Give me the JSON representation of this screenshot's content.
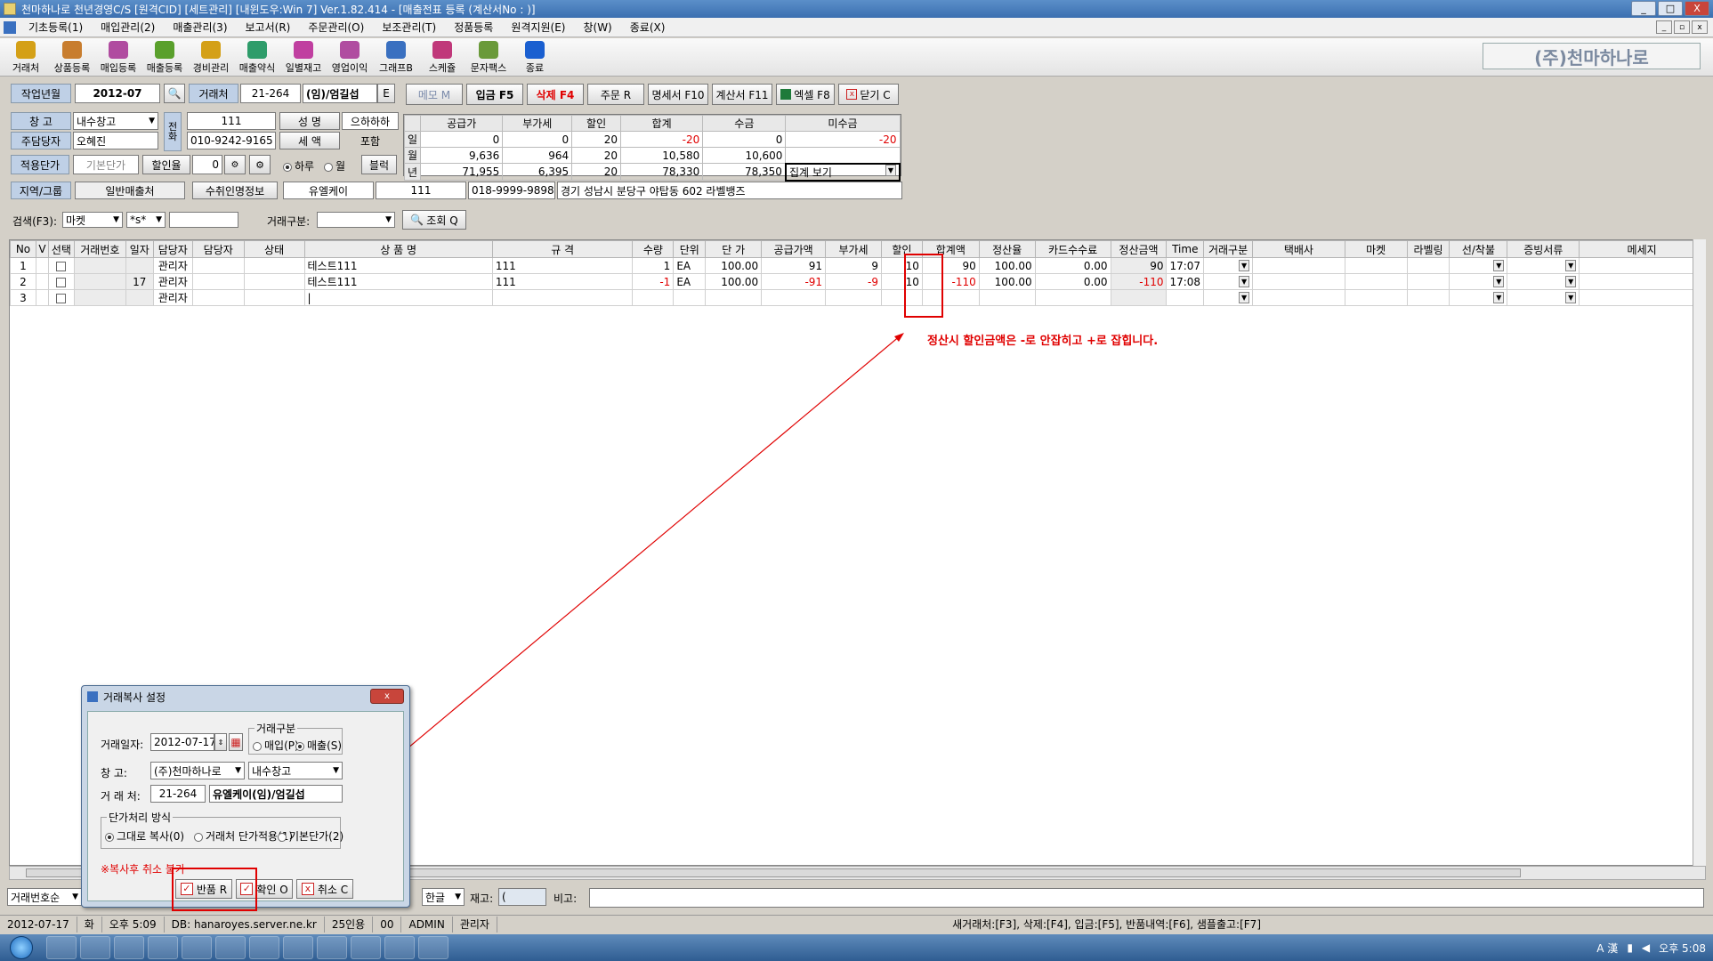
{
  "window": {
    "title": "천마하나로 천년경영C/S [원격CID] [세트관리] [내윈도우:Win 7] Ver.1.82.414 - [매출전표 등록 (계산서No : )]",
    "min": "_",
    "max": "□",
    "close": "X"
  },
  "menu": [
    "기초등록(1)",
    "매입관리(2)",
    "매출관리(3)",
    "보고서(R)",
    "주문관리(O)",
    "보조관리(T)",
    "정품등록",
    "원격지원(E)",
    "창(W)",
    "종료(X)"
  ],
  "toolbar": [
    {
      "label": "거래처",
      "icon": "handshake-icon",
      "color": "#d4a017"
    },
    {
      "label": "상품등록",
      "icon": "box-icon",
      "color": "#c87d2e"
    },
    {
      "label": "매입등록",
      "icon": "purchase-icon",
      "color": "#b04ca0"
    },
    {
      "label": "매출등록",
      "icon": "sales-icon",
      "color": "#5aa02c"
    },
    {
      "label": "경비관리",
      "icon": "coins-icon",
      "color": "#d4a017"
    },
    {
      "label": "매출약식",
      "icon": "pen-icon",
      "color": "#2e9c6a"
    },
    {
      "label": "일별재고",
      "icon": "stock-icon",
      "color": "#c03fa0"
    },
    {
      "label": "영업이익",
      "icon": "profit-icon",
      "color": "#b04ca0"
    },
    {
      "label": "그래프B",
      "icon": "graph-icon",
      "color": "#3a70c0"
    },
    {
      "label": "스케쥴",
      "icon": "schedule-icon",
      "color": "#c0387a"
    },
    {
      "label": "문자팩스",
      "icon": "phone-icon",
      "color": "#6a9a3a"
    },
    {
      "label": "종료",
      "icon": "exit-icon",
      "color": "#1a5fd0"
    }
  ],
  "brand": "(주)천마하나로",
  "header": {
    "workmonth_label": "작업년월",
    "workmonth": "2012-07",
    "client_label": "거래처",
    "client_code": "21-264",
    "client_name": "(임)/엄길섭",
    "e_btn": "E",
    "memo_btn": "메모 M",
    "deposit_btn": "입금 F5",
    "delete_btn": "삭제 F4",
    "order_btn": "주문 R",
    "statement_btn": "명세서 F10",
    "invoice_btn": "계산서 F11",
    "excel_btn": "엑셀 F8",
    "close_btn": "닫기 C"
  },
  "form": {
    "warehouse_label": "창   고",
    "warehouse": "내수창고",
    "manager_label": "주담당자",
    "manager": "오혜진",
    "price_label": "적용단가",
    "price": "기본단가",
    "discount_label": "할인율",
    "discount": "0",
    "phone_label": "전화",
    "code": "111",
    "name_label": "성 명",
    "tax_label": "세 액",
    "tax_val": "포함",
    "phone": "010-9242-9165",
    "name_right": "으하하하",
    "period_daily": "하루",
    "period_monthly": "월",
    "block_btn": "블럭"
  },
  "summary": {
    "headers": [
      "",
      "공급가",
      "부가세",
      "할인",
      "합계",
      "수금",
      "미수금"
    ],
    "rows": [
      {
        "label": "일",
        "values": [
          "0",
          "0",
          "20",
          "-20",
          "0",
          "-20"
        ]
      },
      {
        "label": "월",
        "values": [
          "9,636",
          "964",
          "20",
          "10,580",
          "10,600",
          ""
        ]
      },
      {
        "label": "년",
        "values": [
          "71,955",
          "6,395",
          "20",
          "78,330",
          "78,350",
          "집계 보기"
        ]
      }
    ]
  },
  "region": {
    "label": "지역/그룹",
    "group": "일반매출처",
    "recipient_label": "수취인명정보",
    "company": "유엘케이",
    "code": "111",
    "phone": "018-9999-9898",
    "address": "경기 성남시 분당구 야탑동 602 라벨뱅즈"
  },
  "search": {
    "label": "검색(F3):",
    "type": "마켓",
    "op": "*s*",
    "value": "",
    "trade_label": "거래구분:",
    "trade": "",
    "query_btn": "조회 Q"
  },
  "grid": {
    "headers": [
      "No",
      "V",
      "선택",
      "거래번호",
      "일자",
      "담당자",
      "담당자",
      "상태",
      "상 품 명",
      "규 격",
      "수량",
      "단위",
      "단 가",
      "공급가액",
      "부가세",
      "할인",
      "합계액",
      "정산율",
      "카드수수료",
      "정산금액",
      "Time",
      "거래구분",
      "택배사",
      "마켓",
      "라벨링",
      "선/착불",
      "증빙서류",
      "메세지"
    ],
    "rows": [
      {
        "no": "1",
        "date": "",
        "mgr": "관리자",
        "product": "테스트111",
        "spec": "111",
        "qty": "1",
        "unit": "EA",
        "price": "100.00",
        "supply": "91",
        "vat": "9",
        "disc": "10",
        "total": "90",
        "rate": "100.00",
        "card": "0.00",
        "settle": "90",
        "time": "17:07"
      },
      {
        "no": "2",
        "date": "17",
        "mgr": "관리자",
        "product": "테스트111",
        "spec": "111",
        "qty": "-1",
        "unit": "EA",
        "price": "100.00",
        "supply": "-91",
        "vat": "-9",
        "disc": "10",
        "total": "-110",
        "rate": "100.00",
        "card": "0.00",
        "settle": "-110",
        "time": "17:08"
      },
      {
        "no": "3",
        "date": "",
        "mgr": "관리자",
        "product": "|",
        "spec": "",
        "qty": "",
        "unit": "",
        "price": "",
        "supply": "",
        "vat": "",
        "disc": "",
        "total": "",
        "rate": "",
        "card": "",
        "settle": "",
        "time": ""
      }
    ]
  },
  "annotation": "정산시 할인금액은 -로 안잡히고 +로 잡힙니다.",
  "bottom": {
    "sort": "거래번호순",
    "lang": "한글",
    "stock_label": "재고:",
    "stock": "(",
    "memo_label": "비고:"
  },
  "status": [
    "2012-07-17",
    "화",
    "오후 5:09",
    "DB: hanaroyes.server.ne.kr",
    "25인용",
    "00",
    "ADMIN",
    "관리자"
  ],
  "status_right": "새거래처:[F3], 삭제:[F4], 입금:[F5], 반품내역:[F6], 샘플출고:[F7]",
  "tray": {
    "lang": "A 漢",
    "time": "오후 5:08"
  },
  "dialog": {
    "title": "거래복사 설정",
    "date_label": "거래일자:",
    "date": "2012-07-17",
    "trade_group": "거래구분",
    "buy": "매입(P)",
    "sell": "매출(S)",
    "wh_label": "창     고:",
    "wh_company": "(주)천마하나로",
    "wh_name": "내수창고",
    "client_label": "거 래 처:",
    "client_code": "21-264",
    "client_name": "유엘케이(임)/엄길섭",
    "price_group": "단가처리 방식",
    "opt1": "그대로 복사(0)",
    "opt2": "거래처 단가적용(1)",
    "opt3": "기본단가(2)",
    "warning": "※복사후 취소 불가",
    "return_btn": "반품 R",
    "ok_btn": "확인 O",
    "cancel_btn": "취소 C"
  }
}
